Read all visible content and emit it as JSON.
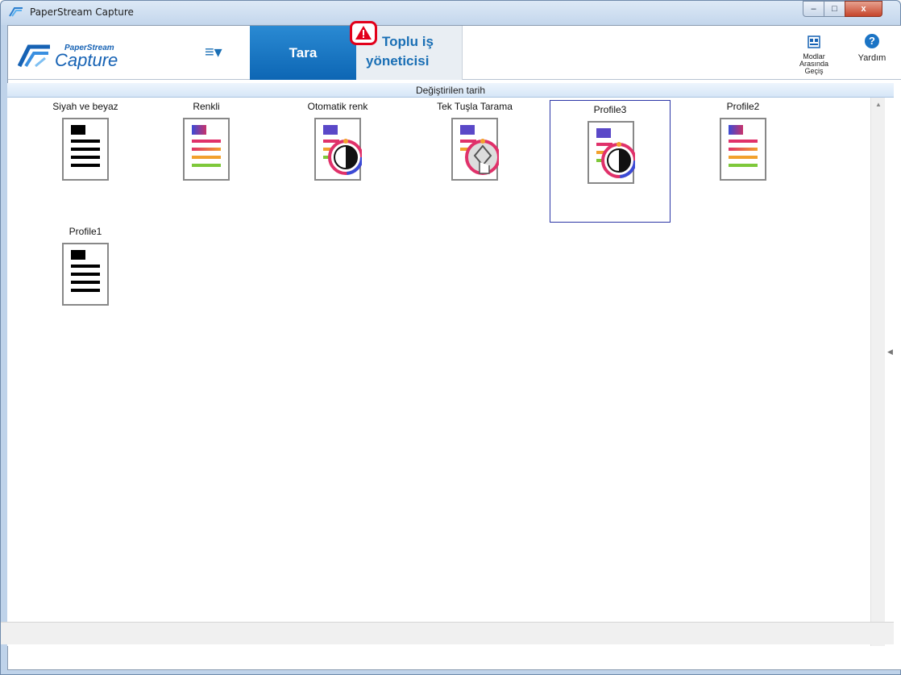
{
  "window": {
    "title": "PaperStream Capture",
    "controls": {
      "minimize": "–",
      "maximize": "□",
      "close": "x"
    }
  },
  "brand": {
    "line1": "PaperStream",
    "line2": "Capture"
  },
  "toolbar": {
    "menu_glyph": "≡▾",
    "tabs": [
      {
        "label": "Tara"
      },
      {
        "label_line1": "Toplu iş",
        "label_line2": "yöneticisi"
      }
    ],
    "modes_label_lines": [
      "Modlar",
      "Arasında",
      "Geçiş"
    ],
    "help_glyph": "?",
    "help_label": "Yardım"
  },
  "sort": {
    "label": "Değiştirilen tarih"
  },
  "profiles": [
    {
      "label": "Siyah ve beyaz",
      "icon": "bw-document-icon"
    },
    {
      "label": "Renkli",
      "icon": "color-document-icon"
    },
    {
      "label": "Otomatik renk",
      "icon": "auto-color-document-icon"
    },
    {
      "label": "Tek Tuşla Tarama",
      "icon": "one-touch-scan-icon"
    },
    {
      "label": "Profile3",
      "icon": "auto-color-document-icon",
      "selected": true
    },
    {
      "label": "Profile2",
      "icon": "color-document-icon"
    },
    {
      "label": "Profile1",
      "icon": "bw-document-icon"
    }
  ],
  "colors": {
    "accent": "#1a6fb5",
    "tab_active": "#0d66b4",
    "warning": "#e2001a",
    "selection": "#2b36a6"
  }
}
